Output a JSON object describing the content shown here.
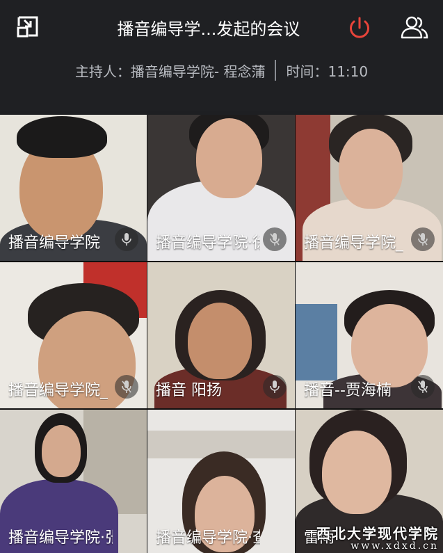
{
  "header": {
    "title": "播音编导学...发起的会议",
    "host": "主持人：播音编导学院- 程念蒲",
    "time": "时间：11:10"
  },
  "icons": {
    "minimize": "picture-in-picture-minimize-icon",
    "power": "power-icon",
    "members": "members-icon",
    "mic": "microphone-icon"
  },
  "colors": {
    "accent_red": "#e8443a",
    "background": "#1f2023",
    "subtext": "#b9bcc2"
  },
  "participants": [
    {
      "name": "播音编导学院"
    },
    {
      "name": "播音编导学院·徐"
    },
    {
      "name": "播音编导学院_"
    },
    {
      "name": "播音编导学院_"
    },
    {
      "name": "播音 阳扬"
    },
    {
      "name": "播音--贾海楠"
    },
    {
      "name": "播音编导学院·张"
    },
    {
      "name": "播音编导学院·查"
    },
    {
      "name": "雷雨"
    }
  ],
  "watermark": {
    "line1": "西北大学现代学院",
    "line2": "www.xdxd.cn"
  }
}
